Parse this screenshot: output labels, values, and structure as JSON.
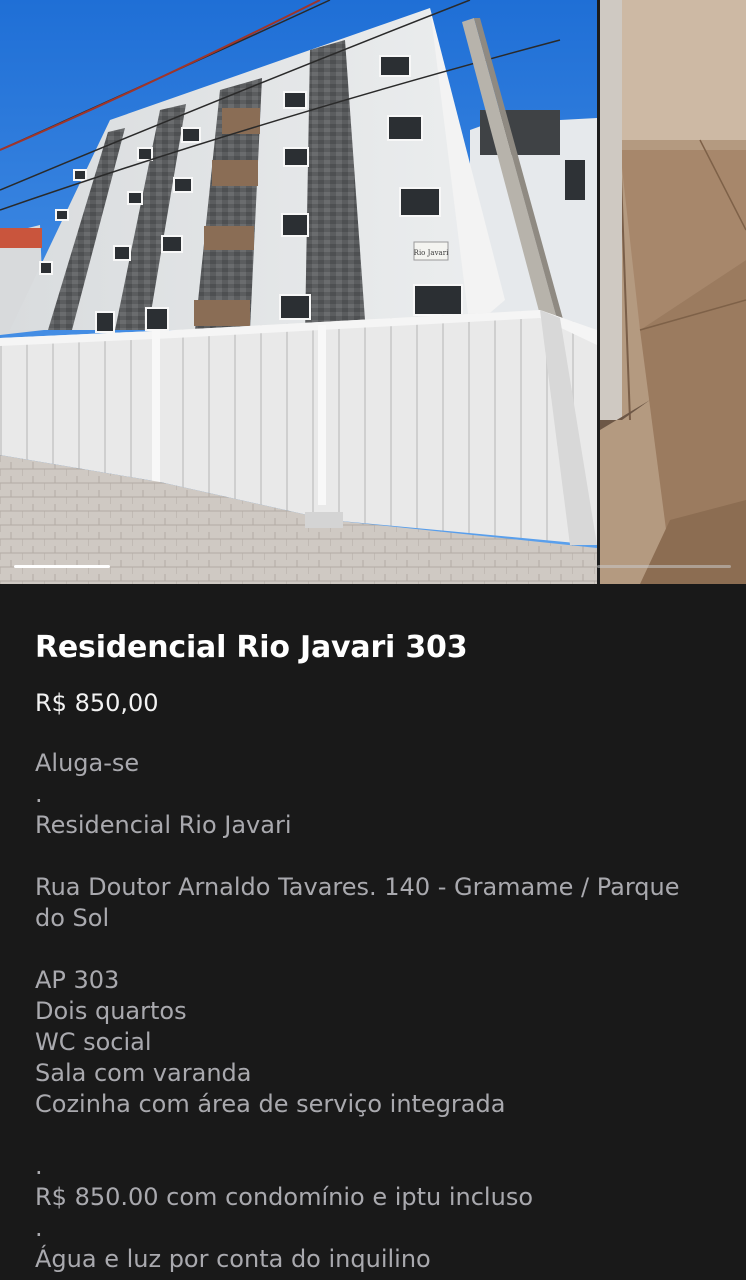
{
  "listing": {
    "title": "Residencial Rio Javari 303",
    "price": "R$ 850,00",
    "description": [
      "Aluga-se",
      ".",
      "Residencial Rio Javari",
      "",
      "Rua Doutor Arnaldo Tavares. 140 - Gramame / Parque do Sol",
      "",
      "AP 303",
      "Dois quartos",
      "WC social",
      "Sala com varanda",
      "Cozinha com área de serviço integrada",
      "",
      ".",
      "R$ 850.00 com condomínio e iptu incluso",
      ".",
      "Água e luz por conta do inquilino"
    ]
  },
  "building_sign": "Rio Javari",
  "carousel": {
    "photos": [
      "building-exterior-photo",
      "interior-floor-photo"
    ],
    "current_index": 1
  }
}
